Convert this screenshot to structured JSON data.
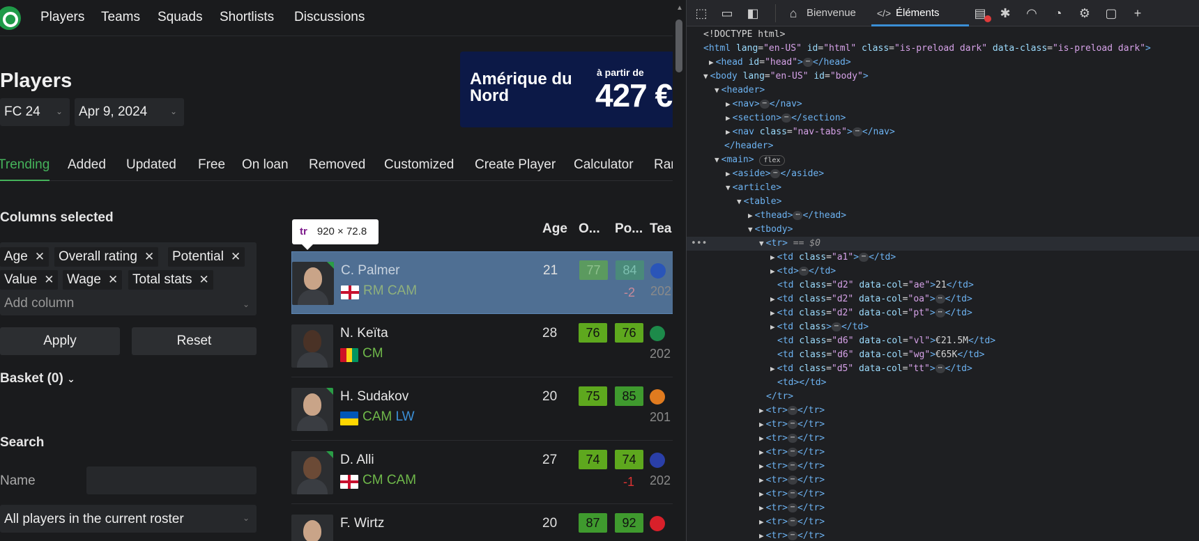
{
  "nav": {
    "links": [
      "Players",
      "Teams",
      "Squads",
      "Shortlists",
      "Discussions"
    ]
  },
  "page": {
    "title": "Players",
    "game_select": "FC 24",
    "date_select": "Apr 9, 2024"
  },
  "ad": {
    "line1": "Amérique du Nord",
    "line2": "à partir de",
    "price": "427 €"
  },
  "tabs": [
    "Trending",
    "Added",
    "Updated",
    "Free",
    "On loan",
    "Removed",
    "Customized",
    "Create Player",
    "Calculator",
    "Ran"
  ],
  "sidebar": {
    "columns_heading": "Columns selected",
    "chips": [
      "Age",
      "Overall rating",
      "Potential",
      "Value",
      "Wage",
      "Total stats"
    ],
    "add_column_placeholder": "Add column",
    "apply_label": "Apply",
    "reset_label": "Reset",
    "basket_label": "Basket (0)",
    "search_heading": "Search",
    "name_label": "Name",
    "roster_select": "All players in the current roster"
  },
  "table": {
    "headers": [
      "Age",
      "O...",
      "Po...",
      "Tea"
    ],
    "tooltip": {
      "tag": "tr",
      "size": "920 × 72.8"
    },
    "rows": [
      {
        "name": "C. Palmer",
        "pos1": "RM CAM",
        "pos2": "",
        "age": "21",
        "ovr": "77",
        "pot": "84",
        "delta": "-2",
        "year": "202",
        "flag": "england"
      },
      {
        "name": "N. Keïta",
        "pos1": "CM",
        "pos2": "",
        "age": "28",
        "ovr": "76",
        "pot": "76",
        "delta": "",
        "year": "202",
        "flag": "guinea"
      },
      {
        "name": "H. Sudakov",
        "pos1": "CAM",
        "pos2": "LW",
        "age": "20",
        "ovr": "75",
        "pot": "85",
        "delta": "",
        "year": "201",
        "flag": "ukraine"
      },
      {
        "name": "D. Alli",
        "pos1": "CM CAM",
        "pos2": "",
        "age": "27",
        "ovr": "74",
        "pot": "74",
        "delta": "-1",
        "year": "202",
        "flag": "england"
      },
      {
        "name": "F. Wirtz",
        "pos1": "",
        "pos2": "",
        "age": "20",
        "ovr": "87",
        "pot": "92",
        "delta": "",
        "year": "",
        "flag": ""
      }
    ]
  },
  "devtools": {
    "tab_home": "Bienvenue",
    "tab_elements": "Éléments",
    "lines": {
      "doctype": "<!DOCTYPE html>",
      "html_open": "<html",
      "html_lang": "en-US",
      "html_id": "html",
      "html_class": "is-preload  dark",
      "html_dataclass": "is-preload  dark",
      "eq0": "== $0",
      "td_age": "21",
      "td_vl": "€21.5M",
      "td_wg": "€65K",
      "flex": "flex"
    }
  },
  "colors": {
    "accent": "#45b35b",
    "rating_green": "#5ea81e",
    "rating_dark": "#3f9a2e",
    "highlight": "#4f6f93",
    "devtools_selected_tab": "#3b8fd6"
  }
}
